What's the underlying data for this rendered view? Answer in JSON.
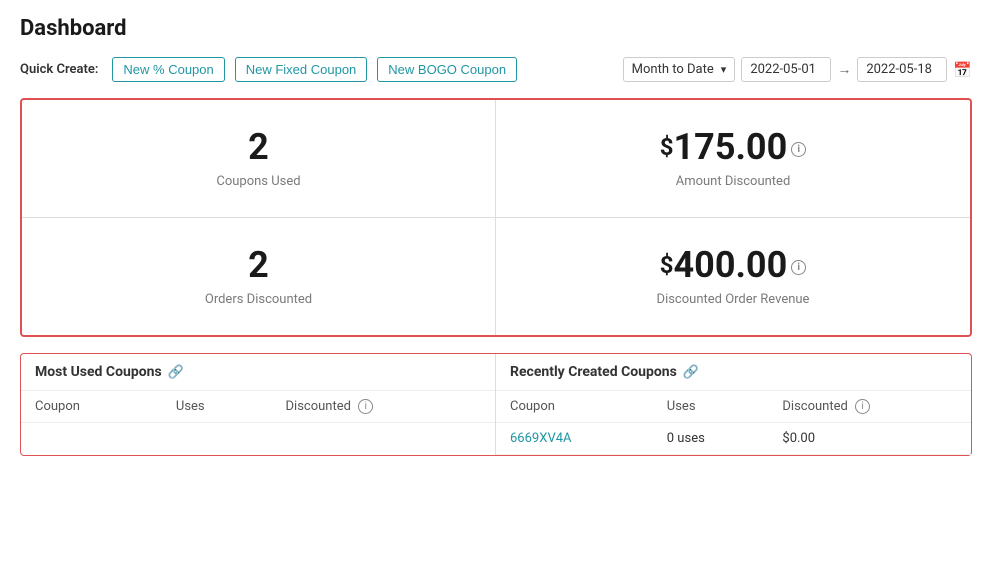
{
  "page": {
    "title": "Dashboard"
  },
  "toolbar": {
    "quick_create_label": "Quick Create:",
    "buttons": [
      {
        "label": "New % Coupon",
        "key": "new-percent"
      },
      {
        "label": "New Fixed Coupon",
        "key": "new-fixed"
      },
      {
        "label": "New BOGO Coupon",
        "key": "new-bogo"
      }
    ],
    "date_filter": {
      "period_label": "Month to Date",
      "date_from": "2022-05-01",
      "date_to": "2022-05-18",
      "arrow": "→"
    }
  },
  "stats": [
    {
      "value": "2",
      "label": "Coupons Used",
      "is_currency": false,
      "has_info": false
    },
    {
      "value": "175.00",
      "label": "Amount Discounted",
      "is_currency": true,
      "has_info": true
    },
    {
      "value": "2",
      "label": "Orders Discounted",
      "is_currency": false,
      "has_info": false
    },
    {
      "value": "400.00",
      "label": "Discounted Order Revenue",
      "is_currency": true,
      "has_info": true
    }
  ],
  "most_used_table": {
    "title": "Most Used Coupons",
    "columns": [
      "Coupon",
      "Uses",
      "Discounted"
    ],
    "rows": []
  },
  "recently_created_table": {
    "title": "Recently Created Coupons",
    "columns": [
      "Coupon",
      "Uses",
      "Discounted"
    ],
    "rows": [
      {
        "coupon": "6669XV4A",
        "uses": "0 uses",
        "discounted": "$0.00"
      }
    ]
  }
}
